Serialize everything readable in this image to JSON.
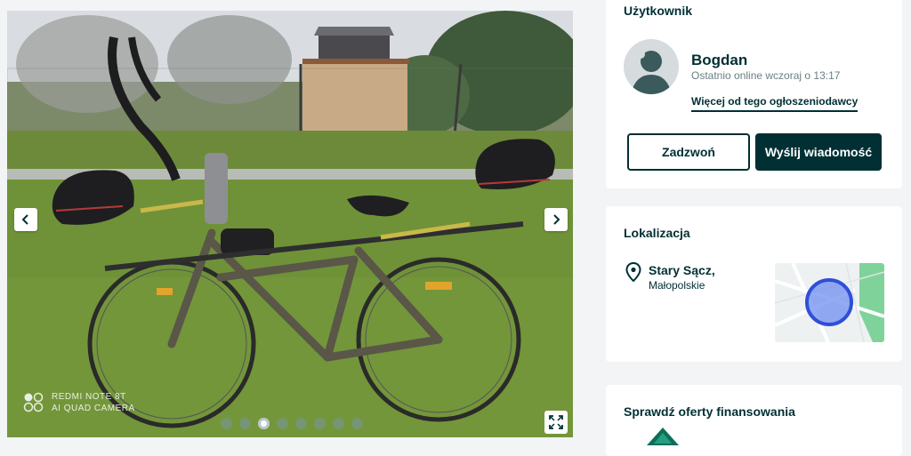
{
  "gallery": {
    "watermark_line1": "REDMI NOTE 8T",
    "watermark_line2": "AI QUAD CAMERA",
    "slide_count": 8,
    "active_slide": 3,
    "prev_icon": "chevron-left-icon",
    "next_icon": "chevron-right-icon",
    "expand_icon": "expand-icon"
  },
  "user_card": {
    "title": "Użytkownik",
    "name": "Bogdan",
    "last_online": "Ostatnio online wczoraj o 13:17",
    "more_link": "Więcej od tego ogłoszeniodawcy",
    "call_button": "Zadzwoń",
    "message_button": "Wyślij wiadomość"
  },
  "location_card": {
    "title": "Lokalizacja",
    "city": "Stary Sącz,",
    "region": "Małopolskie"
  },
  "finance_card": {
    "title": "Sprawdź oferty finansowania"
  },
  "colors": {
    "primary": "#002f34",
    "page_bg": "#f2f4f5",
    "map_circle": "#3a5bd9",
    "map_green": "#7fd39a"
  }
}
